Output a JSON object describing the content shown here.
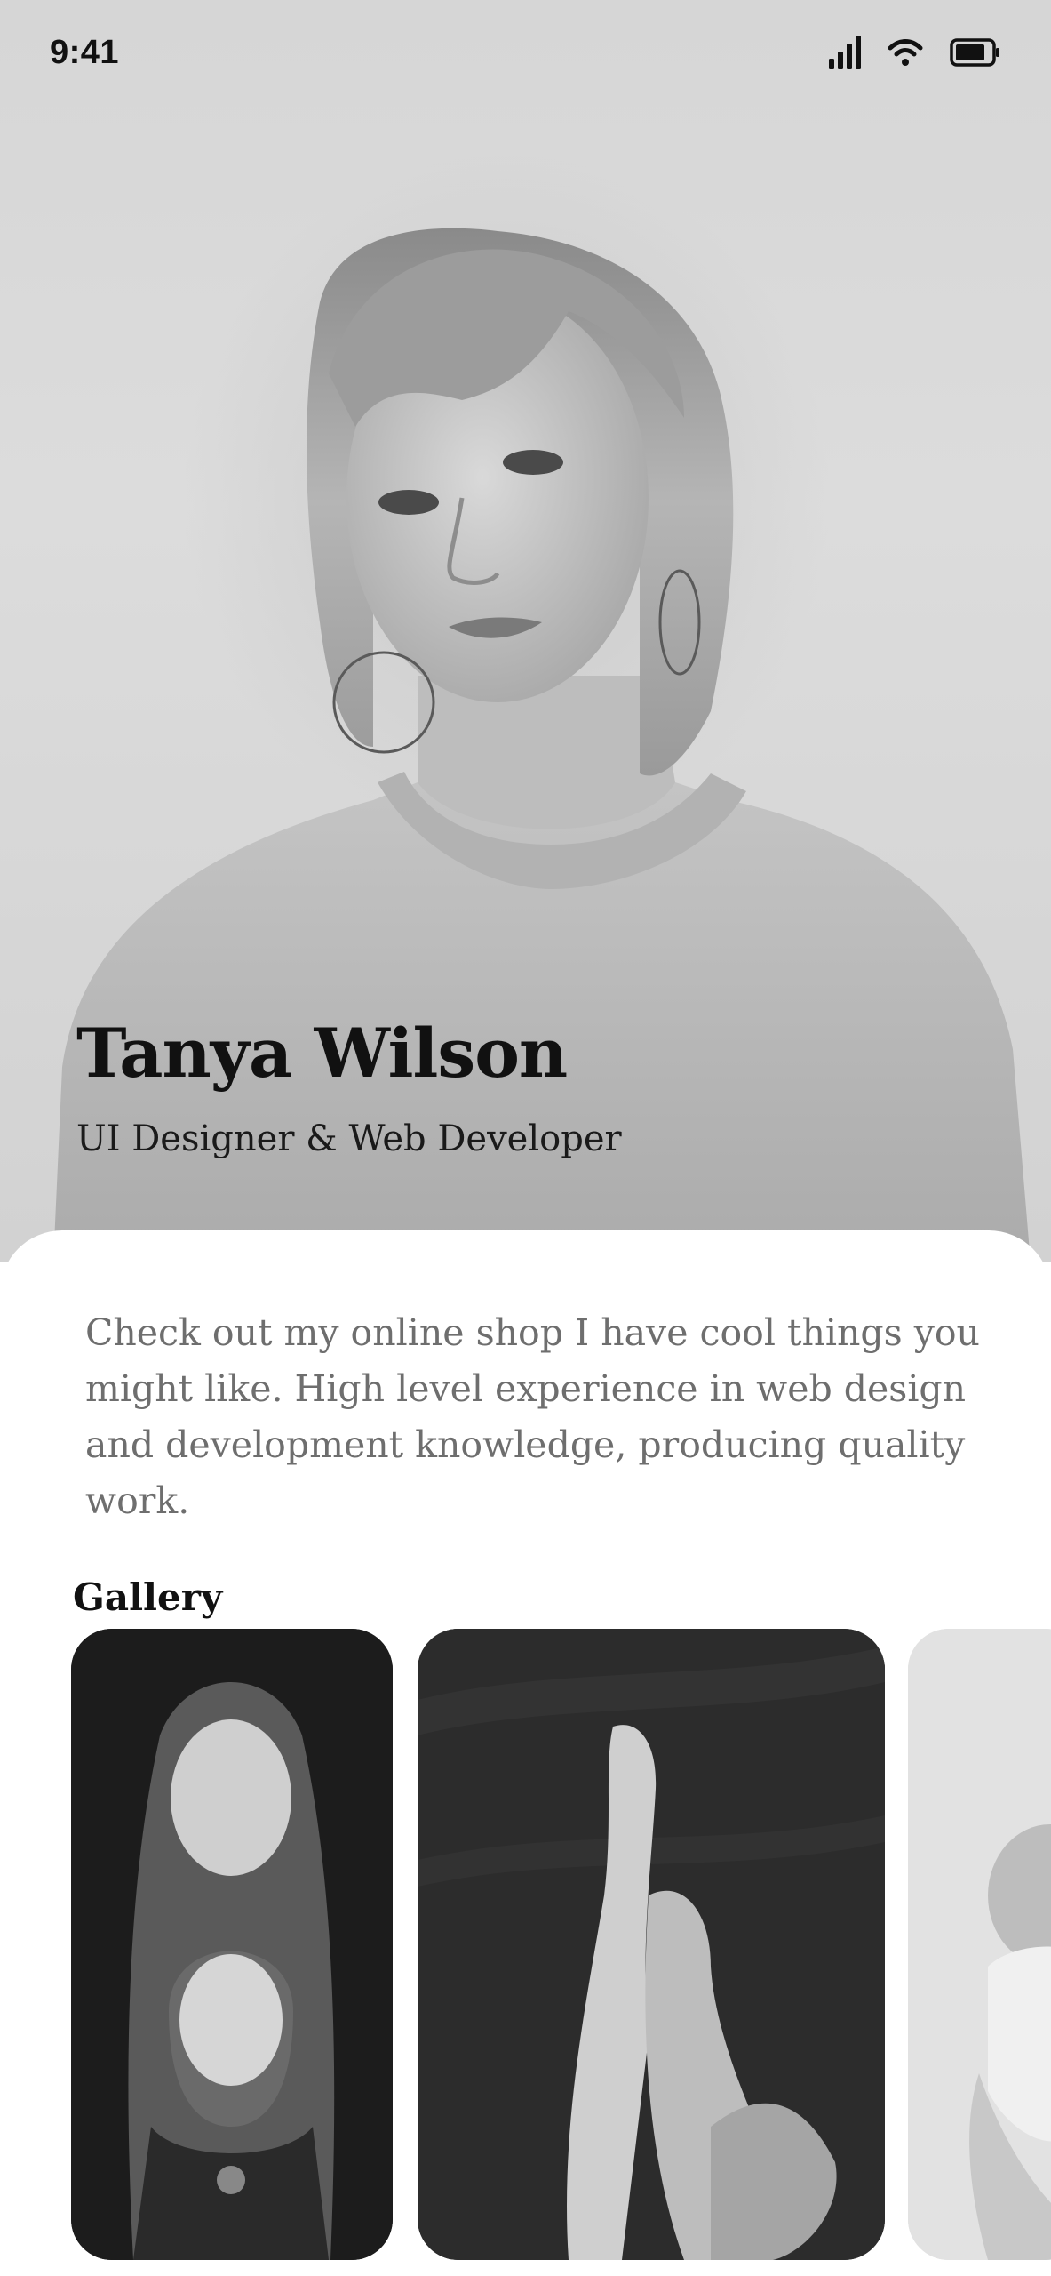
{
  "status_bar": {
    "time": "9:41",
    "icons": [
      "cellular-signal-icon",
      "wifi-icon",
      "battery-icon"
    ]
  },
  "profile": {
    "name": "Tanya Wilson",
    "role": "UI Designer & Web Developer",
    "photo": "portrait-photo"
  },
  "bio": {
    "text": "Check out my online shop I have cool things you might like. High level experience in web design and development knowledge, producing quality work."
  },
  "gallery": {
    "title": "Gallery",
    "items": [
      "gallery-photo-mother-daughter",
      "gallery-photo-legs-water",
      "gallery-photo-baby"
    ]
  },
  "colors": {
    "background": "#ffffff",
    "text_primary": "#111111",
    "text_secondary": "#6e6e6e",
    "hero_bg": "#d6d6d6"
  }
}
